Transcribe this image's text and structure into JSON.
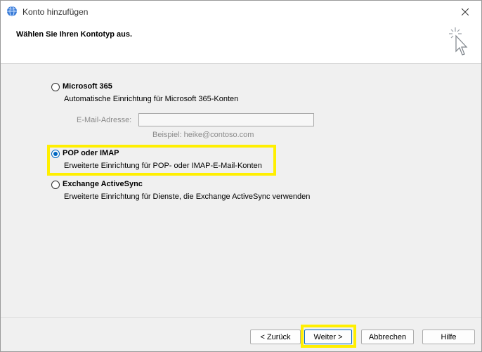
{
  "window": {
    "title": "Konto hinzufügen"
  },
  "header": {
    "title": "Wählen Sie Ihren Kontotyp aus."
  },
  "options": [
    {
      "label": "Microsoft 365",
      "description": "Automatische Einrichtung für Microsoft 365-Konten",
      "selected": false
    },
    {
      "label": "POP oder IMAP",
      "description": "Erweiterte Einrichtung für POP- oder IMAP-E-Mail-Konten",
      "selected": true
    },
    {
      "label": "Exchange ActiveSync",
      "description": "Erweiterte Einrichtung für Dienste, die Exchange ActiveSync verwenden",
      "selected": false
    }
  ],
  "email": {
    "label": "E-Mail-Adresse:",
    "value": "",
    "example": "Beispiel: heike@contoso.com"
  },
  "buttons": {
    "back": "< Zurück",
    "next": "Weiter >",
    "cancel": "Abbrechen",
    "help": "Hilfe"
  },
  "colors": {
    "accent": "#0067c0",
    "highlight": "#ffef00"
  }
}
